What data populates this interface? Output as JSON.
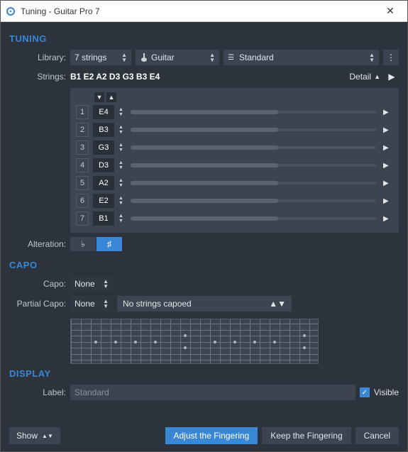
{
  "window": {
    "title": "Tuning - Guitar Pro 7"
  },
  "tuning": {
    "heading": "TUNING",
    "library_label": "Library:",
    "strings_count": "7 strings",
    "instrument": "Guitar",
    "preset": "Standard",
    "strings_label": "Strings:",
    "strings_summary": "B1 E2 A2 D3 G3 B3 E4",
    "detail_label": "Detail",
    "strings": [
      {
        "n": "1",
        "note": "E4"
      },
      {
        "n": "2",
        "note": "B3"
      },
      {
        "n": "3",
        "note": "G3"
      },
      {
        "n": "4",
        "note": "D3"
      },
      {
        "n": "5",
        "note": "A2"
      },
      {
        "n": "6",
        "note": "E2"
      },
      {
        "n": "7",
        "note": "B1"
      }
    ],
    "alteration_label": "Alteration:",
    "flat": "♭",
    "sharp": "♯"
  },
  "capo": {
    "heading": "CAPO",
    "capo_label": "Capo:",
    "capo_value": "None",
    "partial_label": "Partial Capo:",
    "partial_value": "None",
    "partial_status": "No strings capoed"
  },
  "display": {
    "heading": "DISPLAY",
    "label_label": "Label:",
    "label_value": "Standard",
    "visible_label": "Visible"
  },
  "footer": {
    "show": "Show",
    "adjust": "Adjust the Fingering",
    "keep": "Keep the Fingering",
    "cancel": "Cancel"
  }
}
